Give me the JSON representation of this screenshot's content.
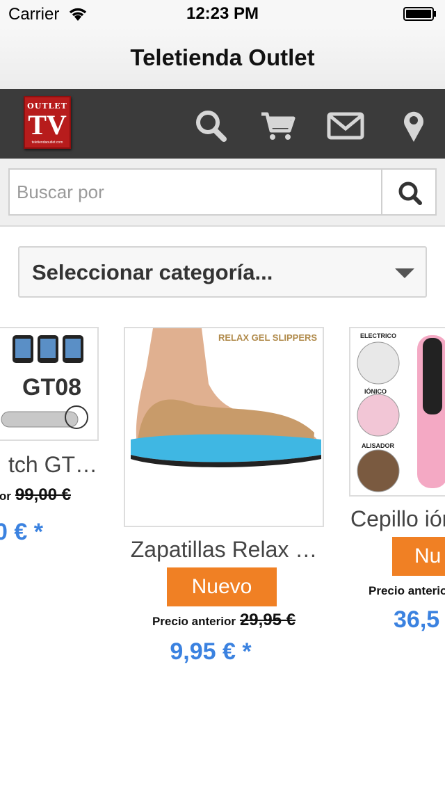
{
  "status_bar": {
    "carrier": "Carrier",
    "time": "12:23 PM",
    "icons": [
      "wifi-icon",
      "battery-icon"
    ]
  },
  "nav": {
    "title": "Teletienda Outlet"
  },
  "toolbar": {
    "logo": {
      "line1": "OUTLET",
      "line2": "TV",
      "line3": "teletiendaoutlet.com"
    },
    "icons": [
      "search-icon",
      "cart-icon",
      "mail-icon",
      "location-pin-icon"
    ],
    "icon_color": "#d6d6d6",
    "background": "#3b3b3b"
  },
  "search": {
    "placeholder": "Buscar por",
    "value": "",
    "button_icon": "search-icon"
  },
  "category": {
    "selected": "Seleccionar categoría..."
  },
  "products": [
    {
      "name": "tch GT…",
      "previous_label": "or",
      "previous_price": "99,00 €",
      "price": "0 € *",
      "image_text": "GT08"
    },
    {
      "name": "Zapatillas Relax …",
      "badge": "Nuevo",
      "previous_label": "Precio anterior",
      "previous_price": "29,95 €",
      "price": "9,95 € *",
      "image_text": "RELAX GEL SLIPPERS"
    },
    {
      "name": "Cepillo ión",
      "badge": "Nu",
      "previous_label": "Precio anterio",
      "previous_price": "",
      "price": "36,5",
      "image_labels": [
        "ELECTRICO",
        "IÓNICO",
        "ALISADOR"
      ]
    }
  ],
  "colors": {
    "accent_orange": "#f08024",
    "price_blue": "#3b82e0"
  }
}
